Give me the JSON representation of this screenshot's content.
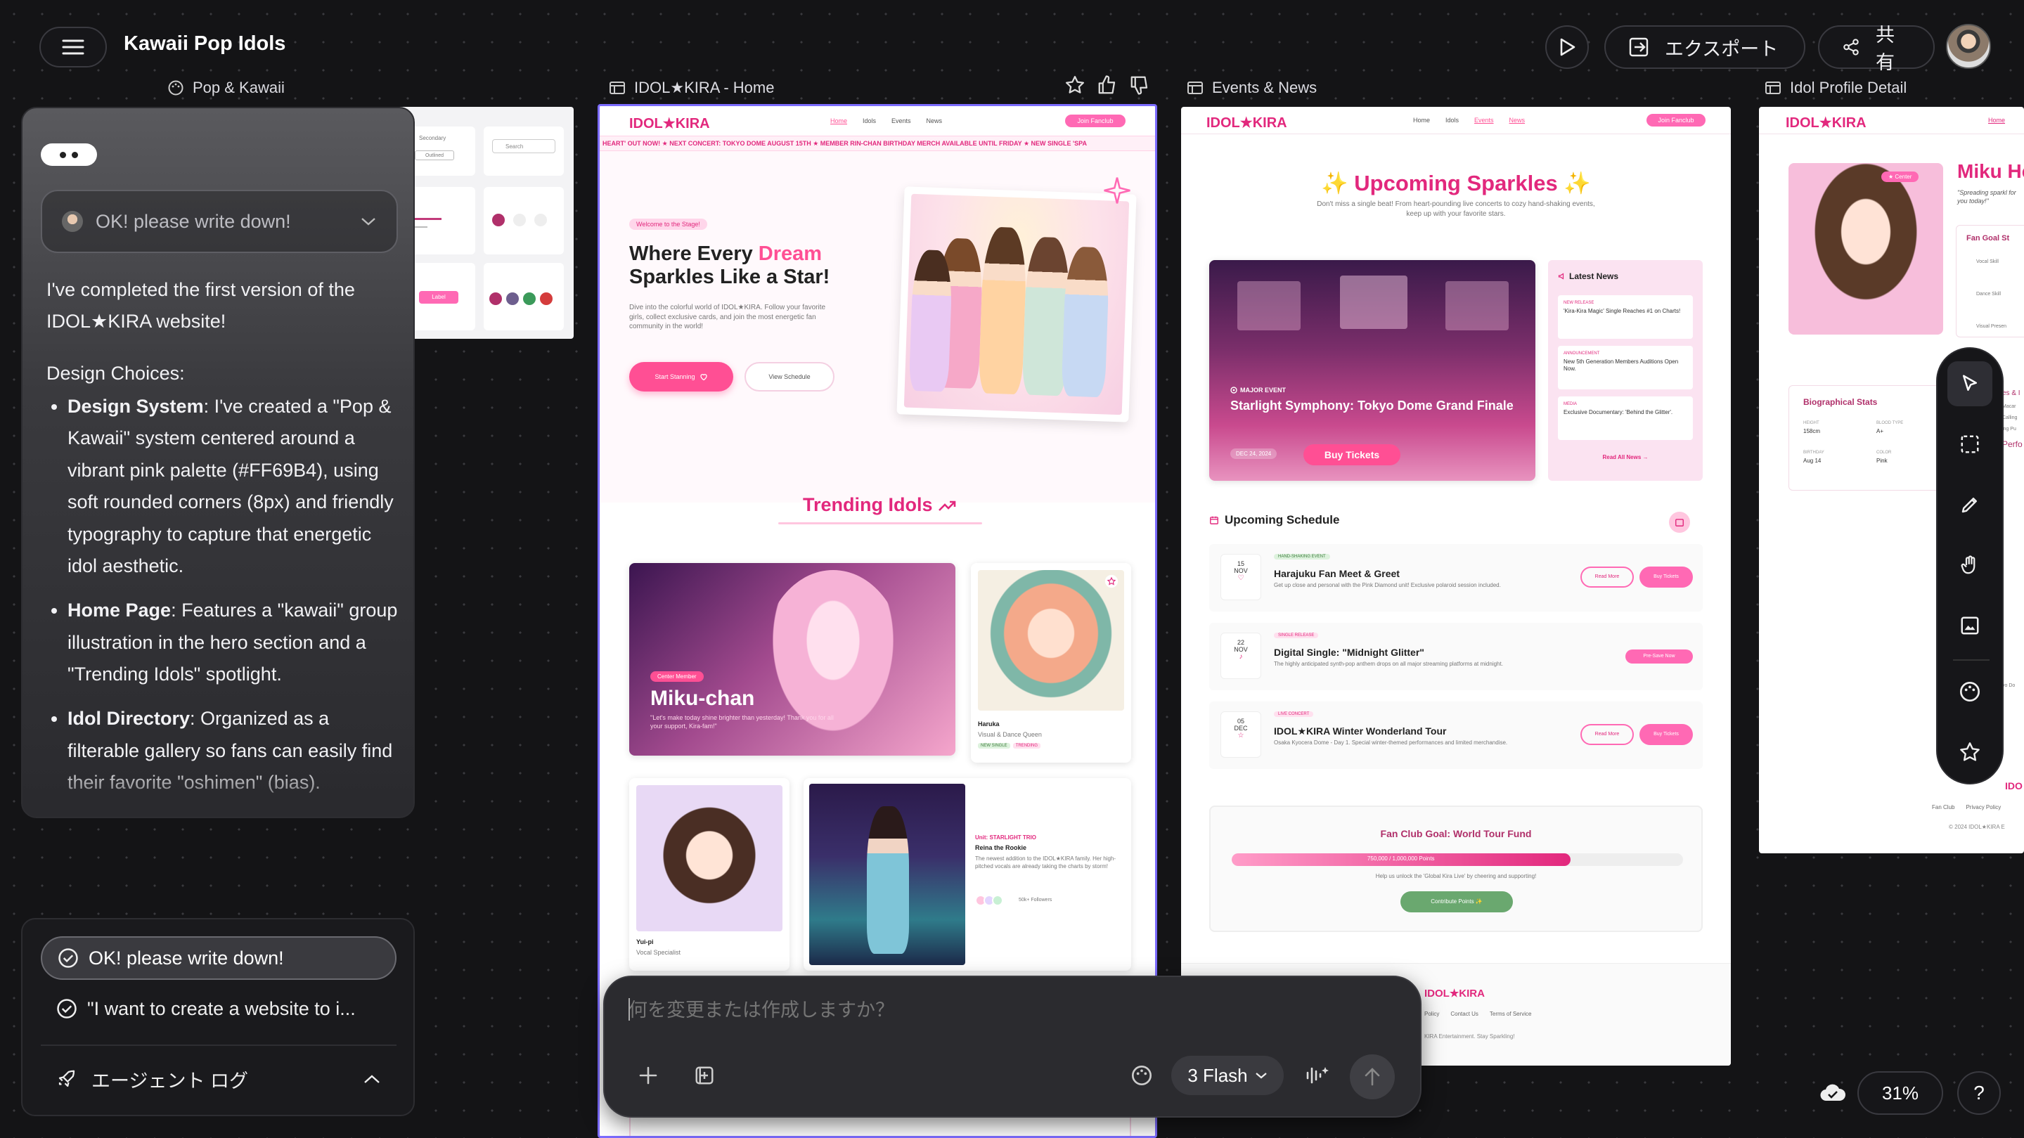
{
  "app": {
    "title": "Kawaii Pop Idols",
    "export_label": "エクスポート",
    "share_label": "共有",
    "zoom": "31%",
    "help_label": "?"
  },
  "frames": {
    "design_system": {
      "label": "Pop & Kawaii"
    },
    "home": {
      "label": "IDOL★KIRA - Home"
    },
    "events": {
      "label": "Events & News"
    },
    "profile": {
      "label": "Idol Profile Detail"
    }
  },
  "design_preview": {
    "secondary": "Secondary",
    "outlined": "Outlined",
    "search": "Search",
    "label": "Label"
  },
  "chat": {
    "dropdown_label": "OK! please write down!",
    "intro": "I've completed the first version of the IDOL★KIRA website!",
    "design_choices_heading": "Design Choices:",
    "bullets": [
      {
        "title": "Design System",
        "text": ": I've created a \"Pop & Kawaii\" system centered around a vibrant pink palette (#FF69B4), using soft rounded corners (8px) and friendly typography to capture that energetic idol aesthetic."
      },
      {
        "title": "Home Page",
        "text": ": Features a \"kawaii\" group illustration in the hero section and a \"Trending Idols\" spotlight."
      },
      {
        "title": "Idol Directory",
        "text": ": Organized as a filterable gallery so fans can easily find their favorite \"oshimen\" (bias)."
      }
    ],
    "history": [
      "OK! please write down!",
      "\"I want to create a website to i..."
    ],
    "agent_log_label": "エージェント ログ"
  },
  "prompt_bar": {
    "placeholder": "何を変更または作成しますか？",
    "model_label": "3 Flash"
  },
  "home": {
    "logo": "IDOL★KIRA",
    "nav": [
      "Home",
      "Idols",
      "Events",
      "News"
    ],
    "join_label": "Join Fanclub",
    "ticker": "HEART' OUT NOW! ★ NEXT CONCERT: TOKYO DOME AUGUST 15TH ★ MEMBER RIN-CHAN BIRTHDAY MERCH AVAILABLE UNTIL FRIDAY ★ NEW SINGLE 'SPA",
    "hero_badge": "Welcome to the Stage!",
    "hero_title_1": "Where Every ",
    "hero_title_accent": "Dream",
    "hero_title_2": "Sparkles Like a Star!",
    "hero_desc": "Dive into the colorful world of IDOL★KIRA. Follow your favorite girls, collect exclusive cards, and join the most energetic fan community in the world!",
    "start_label": "Start Stanning",
    "schedule_label": "View Schedule",
    "trending_title": "Trending Idols",
    "featured": {
      "badge": "Center Member",
      "name": "Miku-chan",
      "quote": "\"Let's make today shine brighter than yesterday! Thank you for all your support, Kira-fam!\""
    },
    "haruka": {
      "name": "Haruka",
      "role": "Visual & Dance Queen",
      "tags": [
        "NEW SINGLE",
        "TRENDING"
      ]
    },
    "yuipi": {
      "name": "Yui-pi",
      "role": "Vocal Specialist"
    },
    "reina": {
      "unit": "Unit: STARLIGHT TRIO",
      "name": "Reina the Rookie",
      "desc": "The newest addition to the IDOL★KIRA family. Her high-pitched vocals are already taking the charts by storm!",
      "followers": "50k+ Followers"
    }
  },
  "events": {
    "logo": "IDOL★KIRA",
    "nav": [
      "Home",
      "Idols",
      "Events",
      "News"
    ],
    "join_label": "Join Fanclub",
    "title": "✨ Upcoming Sparkles ✨",
    "subtitle": "Don't miss a single beat! From heart-pounding live concerts to cozy hand-shaking events, keep up with your favorite stars.",
    "major": {
      "badge": "MAJOR EVENT",
      "title": "Starlight Symphony: Tokyo Dome Grand Finale",
      "date": "DEC 24, 2024",
      "buy_label": "Buy Tickets"
    },
    "news_title": "Latest News",
    "news": [
      {
        "tag": "NEW RELEASE",
        "text": "'Kira-Kira Magic' Single Reaches #1 on Charts!"
      },
      {
        "tag": "ANNOUNCEMENT",
        "text": "New 5th Generation Members Auditions Open Now."
      },
      {
        "tag": "MEDIA",
        "text": "Exclusive Documentary: 'Behind the Glitter'."
      }
    ],
    "read_all": "Read All News →",
    "schedule_title": "Upcoming Schedule",
    "schedule": [
      {
        "day": "15",
        "month": "NOV",
        "tag": "HAND-SHAKING EVENT",
        "title": "Harajuku Fan Meet & Greet",
        "desc": "Get up close and personal with the Pink Diamond unit! Exclusive polaroid session included.",
        "btn1": "Read More",
        "btn2": "Buy Tickets"
      },
      {
        "day": "22",
        "month": "NOV",
        "tag": "SINGLE RELEASE",
        "title": "Digital Single: \"Midnight Glitter\"",
        "desc": "The highly anticipated synth-pop anthem drops on all major streaming platforms at midnight.",
        "btn1": "",
        "btn2": "Pre-Save Now"
      },
      {
        "day": "05",
        "month": "DEC",
        "tag": "LIVE CONCERT",
        "title": "IDOL★KIRA Winter Wonderland Tour",
        "desc": "Osaka Kyocera Dome - Day 1. Special winter-themed performances and limited merchandise.",
        "btn1": "Read More",
        "btn2": "Buy Tickets"
      }
    ],
    "goal_title": "Fan Club Goal: World Tour Fund",
    "goal_progress": 0.75,
    "goal_text": "750,000 / 1,000,000 Points",
    "goal_help": "Help us unlock the 'Global Kira Live' by cheering and supporting!",
    "contribute_label": "Contribute Points ✨",
    "footer_logo": "IDOL★KIRA",
    "footer_links": [
      "Policy",
      "Contact Us",
      "Terms of Service"
    ],
    "footer_copy": "KIRA Entertainment. Stay Sparkling!"
  },
  "profile": {
    "logo": "IDOL★KIRA",
    "nav": [
      "Home"
    ],
    "center_badge": "★ Center",
    "name": "Miku He",
    "quote": "\"Spreading sparkl for you today!\"",
    "fan_goal_title": "Fan Goal St",
    "skills": [
      "Vocal Skill",
      "Dance Skill",
      "Visual Presen"
    ],
    "bio_title": "Biographical Stats",
    "stats": [
      {
        "label": "HEIGHT",
        "value": "158cm"
      },
      {
        "label": "BLOOD TYPE",
        "value": "A+"
      },
      {
        "label": "BIRTHDAY",
        "value": "Aug 14"
      },
      {
        "label": "COLOR",
        "value": "Pink"
      }
    ],
    "side_labels": [
      "es & I",
      "Macar",
      "Calling",
      "ing Pu",
      "Perfo",
      "yo Do"
    ],
    "footer_logo": "IDO",
    "footer_links": [
      "Fan Club",
      "Privacy Policy"
    ],
    "footer_copy": "© 2024 IDOL★KIRA E"
  },
  "colors": {
    "brand_pink": "#FF69B4",
    "selection": "#7c6cff",
    "progress": "#e2287d",
    "success_green": "#6aa86f"
  }
}
